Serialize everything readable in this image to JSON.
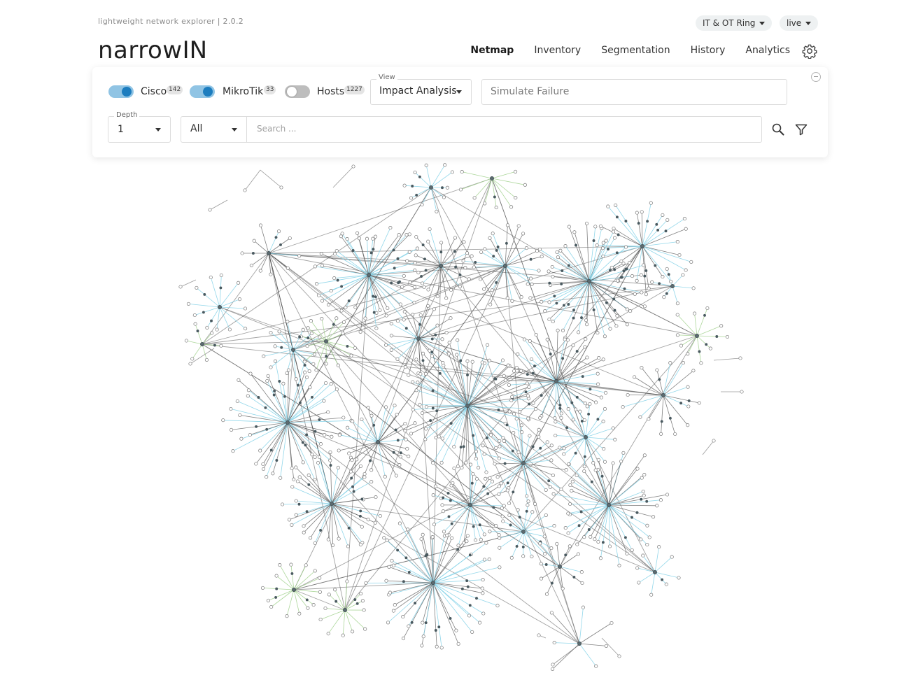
{
  "header": {
    "tagline": "lightweight network explorer | 2.0.2",
    "logo_text_a": "narrow",
    "logo_text_b": "IN",
    "site_selector": "IT & OT Ring",
    "mode_selector": "live"
  },
  "nav": {
    "items": [
      "Netmap",
      "Inventory",
      "Segmentation",
      "History",
      "Analytics"
    ],
    "active": "Netmap"
  },
  "filters": {
    "toggles": [
      {
        "label": "Cisco",
        "count": "142",
        "on": true
      },
      {
        "label": "MikroTik",
        "count": "33",
        "on": true
      },
      {
        "label": "Hosts",
        "count": "1227",
        "on": false
      }
    ],
    "view_legend": "View",
    "view_value": "Impact Analysis",
    "simulate_placeholder": "Simulate Failure",
    "depth_legend": "Depth",
    "depth_value": "1",
    "scope_value": "All",
    "search_placeholder": "Search ..."
  },
  "icons": {
    "settings": "gear-icon",
    "search": "search-icon",
    "filter": "filter-icon",
    "collapse": "collapse-icon"
  },
  "colors": {
    "accent": "#1c7dbf",
    "toggle_track_on": "#90c4e4",
    "edge_core": "#555555",
    "edge_host": "#7fd0e6",
    "edge_green": "#9fd08a",
    "node_fill": "#ffffff",
    "node_stroke": "#777777"
  }
}
